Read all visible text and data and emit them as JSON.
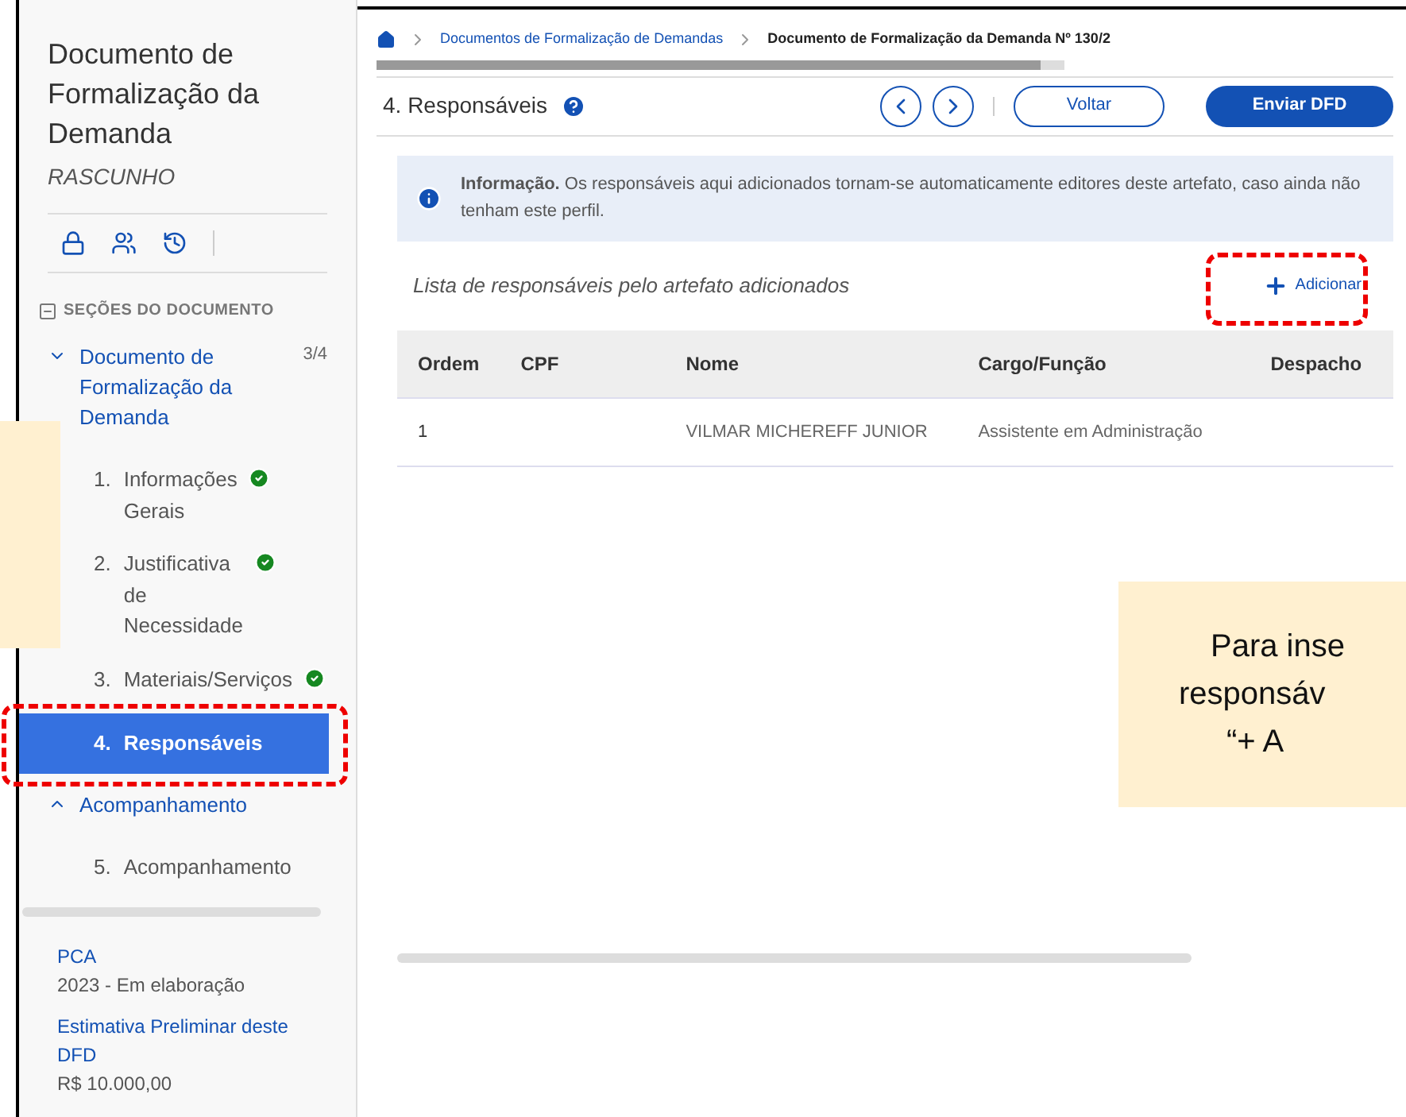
{
  "sidebar": {
    "title": "Documento de Formalização da Demanda",
    "status": "RASCUNHO",
    "sections_heading": "SEÇÕES DO DOCUMENTO",
    "groups": [
      {
        "label": "Documento de Formalização da Demanda",
        "count": "3/4",
        "expanded": true,
        "children": [
          {
            "number": "1.",
            "label": "Informações Gerais",
            "done": true,
            "selected": false
          },
          {
            "number": "2.",
            "label": "Justificativa de Necessidade",
            "done": true,
            "selected": false
          },
          {
            "number": "3.",
            "label": "Materiais/Serviços",
            "done": true,
            "selected": false
          },
          {
            "number": "4.",
            "label": "Responsáveis",
            "done": false,
            "selected": true
          }
        ]
      },
      {
        "label": "Acompanhamento",
        "expanded": false,
        "children": [
          {
            "number": "5.",
            "label": "Acompanhamento",
            "done": false,
            "selected": false
          }
        ]
      }
    ],
    "info": [
      {
        "label": "PCA",
        "value": "2023 - Em elaboração"
      },
      {
        "label": "Estimativa Preliminar deste DFD",
        "value": "R$ 10.000,00"
      }
    ]
  },
  "breadcrumb": [
    "Documentos de Formalização de Demandas",
    "Documento de Formalização da Demanda Nº 130/2"
  ],
  "header": {
    "title": "4. Responsáveis",
    "buttons": [
      "Voltar",
      "Enviar DFD"
    ]
  },
  "alert": {
    "text": "**Informação.** Os responsáveis aqui adicionados tornam-se automaticamente editores deste artefato, caso ainda não tenham este perfil."
  },
  "list": {
    "caption": "Lista de responsáveis pelo artefato adicionados",
    "add_button": "Adicionar",
    "columns": [
      "Ordem",
      "CPF",
      "Nome",
      "Cargo/Função",
      "Despacho"
    ],
    "rows": [
      [
        "1",
        "",
        "VILMAR MICHEREFF JUNIOR",
        "Assistente em Administração",
        ""
      ]
    ]
  },
  "callout": {
    "lines": [
      "Para inse",
      "responsáv",
      "“+ A"
    ]
  }
}
